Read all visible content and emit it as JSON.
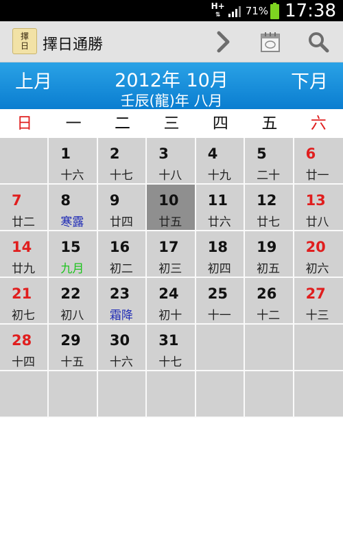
{
  "status_bar": {
    "network": "H+",
    "battery_percent": "71%",
    "time": "17:38"
  },
  "action_bar": {
    "app_icon_text": [
      "擇",
      "日"
    ],
    "title": "擇日通勝",
    "icons": [
      "next-arrow-icon",
      "calendar-icon",
      "search-icon"
    ]
  },
  "month_header": {
    "prev_label": "上月",
    "current_label": "2012年 10月",
    "next_label": "下月",
    "lunar_label": "壬辰(龍)年 八月"
  },
  "weekdays": [
    "日",
    "一",
    "二",
    "三",
    "四",
    "五",
    "六"
  ],
  "colors": {
    "holiday_red": "#e01e1e",
    "solar_term_blue": "#1f2bb5",
    "lunar_month_green": "#1ec41e",
    "header_blue": "#0a7dd0"
  },
  "calendar": {
    "cells": [
      {
        "day": "",
        "lunar": ""
      },
      {
        "day": "1",
        "lunar": "十六"
      },
      {
        "day": "2",
        "lunar": "十七"
      },
      {
        "day": "3",
        "lunar": "十八"
      },
      {
        "day": "4",
        "lunar": "十九"
      },
      {
        "day": "5",
        "lunar": "二十"
      },
      {
        "day": "6",
        "lunar": "廿一",
        "red": true
      },
      {
        "day": "7",
        "lunar": "廿二",
        "red": true
      },
      {
        "day": "8",
        "lunar": "寒露",
        "term": true
      },
      {
        "day": "9",
        "lunar": "廿四"
      },
      {
        "day": "10",
        "lunar": "廿五",
        "today": true
      },
      {
        "day": "11",
        "lunar": "廿六"
      },
      {
        "day": "12",
        "lunar": "廿七"
      },
      {
        "day": "13",
        "lunar": "廿八",
        "red": true
      },
      {
        "day": "14",
        "lunar": "廿九",
        "red": true
      },
      {
        "day": "15",
        "lunar": "九月",
        "newmonth": true
      },
      {
        "day": "16",
        "lunar": "初二"
      },
      {
        "day": "17",
        "lunar": "初三"
      },
      {
        "day": "18",
        "lunar": "初四"
      },
      {
        "day": "19",
        "lunar": "初五"
      },
      {
        "day": "20",
        "lunar": "初六",
        "red": true
      },
      {
        "day": "21",
        "lunar": "初七",
        "red": true
      },
      {
        "day": "22",
        "lunar": "初八"
      },
      {
        "day": "23",
        "lunar": "霜降",
        "term": true
      },
      {
        "day": "24",
        "lunar": "初十"
      },
      {
        "day": "25",
        "lunar": "十一"
      },
      {
        "day": "26",
        "lunar": "十二"
      },
      {
        "day": "27",
        "lunar": "十三",
        "red": true
      },
      {
        "day": "28",
        "lunar": "十四",
        "red": true
      },
      {
        "day": "29",
        "lunar": "十五"
      },
      {
        "day": "30",
        "lunar": "十六"
      },
      {
        "day": "31",
        "lunar": "十七"
      },
      {
        "day": "",
        "lunar": ""
      },
      {
        "day": "",
        "lunar": ""
      },
      {
        "day": "",
        "lunar": ""
      },
      {
        "day": "",
        "lunar": ""
      },
      {
        "day": "",
        "lunar": ""
      },
      {
        "day": "",
        "lunar": ""
      },
      {
        "day": "",
        "lunar": ""
      },
      {
        "day": "",
        "lunar": ""
      },
      {
        "day": "",
        "lunar": ""
      },
      {
        "day": "",
        "lunar": ""
      }
    ]
  }
}
